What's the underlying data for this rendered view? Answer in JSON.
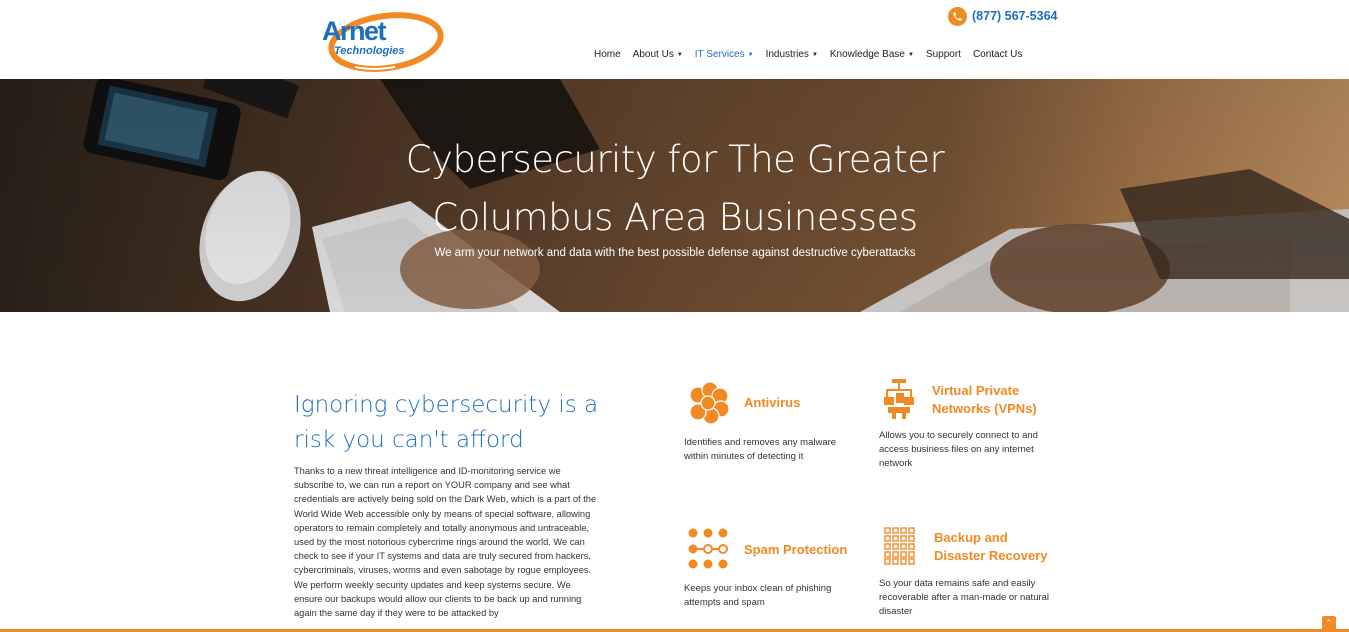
{
  "brand": {
    "logo_line1": "Arnet",
    "logo_line2": "Technologies",
    "phone": "(877) 567-5364",
    "accent_orange": "#f08a24",
    "accent_blue": "#1c6fbf"
  },
  "nav": {
    "items": [
      {
        "label": "Home",
        "has_dropdown": false,
        "active": false
      },
      {
        "label": "About Us",
        "has_dropdown": true,
        "active": false
      },
      {
        "label": "IT Services",
        "has_dropdown": true,
        "active": true
      },
      {
        "label": "Industries",
        "has_dropdown": true,
        "active": false
      },
      {
        "label": "Knowledge Base",
        "has_dropdown": true,
        "active": false
      },
      {
        "label": "Support",
        "has_dropdown": false,
        "active": false
      },
      {
        "label": "Contact Us",
        "has_dropdown": false,
        "active": false
      }
    ]
  },
  "hero": {
    "title_line1": "Cybersecurity for The Greater",
    "title_line2": "Columbus Area Businesses",
    "subtitle": "We arm your network and data with the best possible defense against destructive cyberattacks"
  },
  "intro": {
    "heading_line1": "Ignoring cybersecurity is a",
    "heading_line2": "risk you can't afford",
    "body": "Thanks to a new threat intelligence and ID-monitoring service we subscribe to, we can run a report on YOUR company and see what credentials are actively being sold on the Dark Web, which is a part of the World Wide Web accessible only by means of special software, allowing operators to remain completely and totally anonymous and untraceable, used by the most notorious cybercrime rings around the world. We can check to see if your IT systems and data are truly secured from hackers, cybercriminals, viruses, worms and even sabotage by rogue employees. We perform weekly security updates and keep systems secure. We ensure our backups would allow our clients to be back up and running again the same day if they were to be attacked by"
  },
  "features": [
    {
      "title_line1": "Antivirus",
      "title_line2": "",
      "description": "Identifies and removes any malware within minutes of detecting it",
      "icon": "virus-icon"
    },
    {
      "title_line1": "Virtual Private",
      "title_line2": "Networks (VPNs)",
      "description": "Allows you to securely connect to and access business files on any internet network",
      "icon": "network-icon"
    },
    {
      "title_line1": "Spam Protection",
      "title_line2": "",
      "description": "Keeps your inbox clean of phishing attempts and spam",
      "icon": "dots-filter-icon"
    },
    {
      "title_line1": "Backup and",
      "title_line2": "Disaster Recovery",
      "description": "So your data remains safe and easily recoverable after a man-made or natural disaster",
      "icon": "grid-backup-icon"
    }
  ],
  "scroll_top_icon": "chevron-up-icon"
}
